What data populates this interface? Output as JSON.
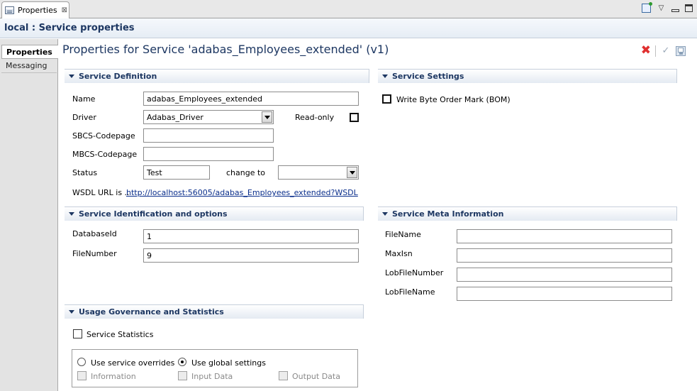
{
  "view_tab": {
    "label": "Properties",
    "close_glyph": "⊠"
  },
  "view_tools": {
    "pin_icon": "pin-icon",
    "menu_glyph": "▽",
    "min_icon": "minimize-icon",
    "max_icon": "maximize-icon"
  },
  "header": {
    "title": "local : Service properties"
  },
  "left_tabs": [
    {
      "label": "Properties",
      "active": true
    },
    {
      "label": "Messaging",
      "active": false
    }
  ],
  "page": {
    "title": "Properties for Service 'adabas_Employees_extended' (v1)"
  },
  "title_tools": {
    "delete_glyph": "✖",
    "validate_glyph": "✓"
  },
  "service_definition": {
    "title": "Service Definition",
    "name_label": "Name",
    "name_value": "adabas_Employees_extended",
    "driver_label": "Driver",
    "driver_value": "Adabas_Driver",
    "readonly_label": "Read-only",
    "sbcs_label": "SBCS-Codepage",
    "sbcs_value": "",
    "mbcs_label": "MBCS-Codepage",
    "mbcs_value": "",
    "status_label": "Status",
    "status_value": "Test",
    "change_to_label": "change to",
    "change_to_value": "",
    "wsdl_label": "WSDL URL is ..",
    "wsdl_url": "http://localhost:56005/adabas_Employees_extended?WSDL"
  },
  "service_settings": {
    "title": "Service Settings",
    "bom_label": "Write Byte Order Mark (BOM)"
  },
  "service_identification": {
    "title": "Service Identification and options",
    "dbid_label": "DatabaseId",
    "dbid_value": "1",
    "fnr_label": "FileNumber",
    "fnr_value": "9"
  },
  "service_meta": {
    "title": "Service Meta Information",
    "filename_label": "FileName",
    "filename_value": "",
    "maxisn_label": "MaxIsn",
    "maxisn_value": "",
    "lobfnr_label": "LobFileNumber",
    "lobfnr_value": "",
    "lobfname_label": "LobFileName",
    "lobfname_value": ""
  },
  "usage_governance": {
    "title": "Usage Governance and Statistics",
    "stats_label": "Service Statistics",
    "overrides_label": "Use service overrides",
    "global_label": "Use global settings",
    "info_label": "Information",
    "input_label": "Input Data",
    "output_label": "Output Data"
  }
}
